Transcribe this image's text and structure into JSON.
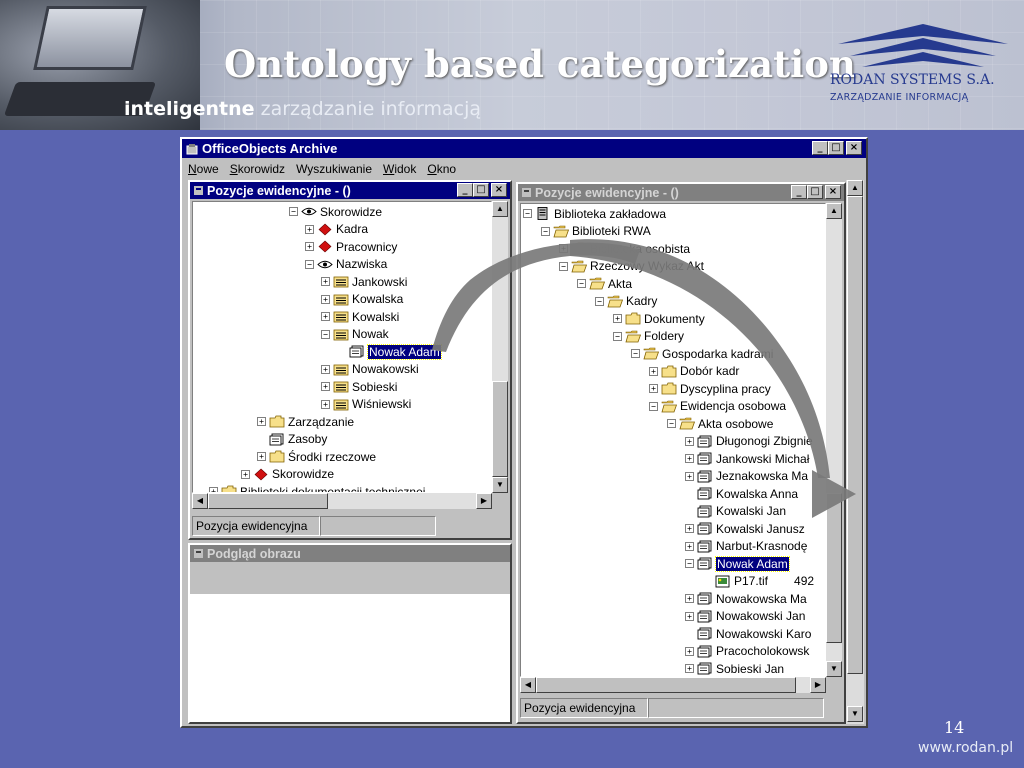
{
  "slide": {
    "title": "Ontology based categorization",
    "tagline_a": "inteligentne",
    "tagline_b": "zarządzanie informacją",
    "logo_name": "RODAN SYSTEMS S.A.",
    "logo_sub": "ZARZĄDZANIE INFORMACJĄ",
    "page_number": "14",
    "footer_url": "www.rodan.pl"
  },
  "app": {
    "title": "OfficeObjects Archive",
    "menu": [
      {
        "u": "N",
        "rest": "owe"
      },
      {
        "u": "S",
        "rest": "korowidz"
      },
      {
        "u": "W",
        "rest": "yszukiwanie"
      },
      {
        "u": "W",
        "rest": "idok"
      },
      {
        "u": "O",
        "rest": "kno"
      }
    ]
  },
  "left_window": {
    "title": "Pozycje ewidencyjne - ()",
    "status": [
      "Pozycja ewidencyjna",
      ""
    ],
    "tree": [
      {
        "label": "Skorowidze",
        "icon": "eye-icon",
        "toggle": "minus",
        "indent": 6
      },
      {
        "label": "Kadra",
        "icon": "diamond-red-icon",
        "toggle": "plus",
        "indent": 7
      },
      {
        "label": "Pracownicy",
        "icon": "diamond-red-icon",
        "toggle": "plus",
        "indent": 7
      },
      {
        "label": "Nazwiska",
        "icon": "eye-icon",
        "toggle": "minus",
        "indent": 7
      },
      {
        "label": "Jankowski",
        "icon": "folder-lines-icon",
        "toggle": "plus",
        "indent": 8
      },
      {
        "label": "Kowalska",
        "icon": "folder-lines-icon",
        "toggle": "plus",
        "indent": 8
      },
      {
        "label": "Kowalski",
        "icon": "folder-lines-icon",
        "toggle": "plus",
        "indent": 8
      },
      {
        "label": "Nowak",
        "icon": "folder-lines-icon",
        "toggle": "minus",
        "indent": 8
      },
      {
        "label": "Nowak Adam",
        "icon": "document-folder-icon",
        "toggle": "none",
        "indent": 9,
        "selected": true
      },
      {
        "label": "Nowakowski",
        "icon": "folder-lines-icon",
        "toggle": "plus",
        "indent": 8
      },
      {
        "label": "Sobieski",
        "icon": "folder-lines-icon",
        "toggle": "plus",
        "indent": 8
      },
      {
        "label": "Wiśniewski",
        "icon": "folder-lines-icon",
        "toggle": "plus",
        "indent": 8
      },
      {
        "label": "Zarządzanie",
        "icon": "folder-icon",
        "toggle": "plus",
        "indent": 4
      },
      {
        "label": "Zasoby",
        "icon": "document-folder-icon",
        "toggle": "none",
        "indent": 4
      },
      {
        "label": "Środki rzeczowe",
        "icon": "folder-icon",
        "toggle": "plus",
        "indent": 4
      },
      {
        "label": "Skorowidze",
        "icon": "diamond-red-icon",
        "toggle": "plus",
        "indent": 3
      },
      {
        "label": "Biblioteki dokumentacji technicznej",
        "icon": "folder-icon",
        "toggle": "plus",
        "indent": 1
      }
    ]
  },
  "preview_window": {
    "title": "Podgląd obrazu"
  },
  "right_window": {
    "title": "Pozycje ewidencyjne - ()",
    "status": [
      "Pozycja ewidencyjna",
      ""
    ],
    "tree": [
      {
        "label": "Biblioteka zakładowa",
        "icon": "server-icon",
        "toggle": "minus",
        "indent": 0
      },
      {
        "label": "Biblioteki RWA",
        "icon": "folder-open-icon",
        "toggle": "minus",
        "indent": 1
      },
      {
        "label": "Biblioteka osobista",
        "icon": "folder-icon",
        "toggle": "plus",
        "indent": 2
      },
      {
        "label": "Rzeczowy Wykaz Akt",
        "icon": "folder-open-icon",
        "toggle": "minus",
        "indent": 2
      },
      {
        "label": "Akta",
        "icon": "folder-open-icon",
        "toggle": "minus",
        "indent": 3
      },
      {
        "label": "Kadry",
        "icon": "folder-open-icon",
        "toggle": "minus",
        "indent": 4
      },
      {
        "label": "Dokumenty",
        "icon": "folder-icon",
        "toggle": "plus",
        "indent": 5
      },
      {
        "label": "Foldery",
        "icon": "folder-open-icon",
        "toggle": "minus",
        "indent": 5
      },
      {
        "label": "Gospodarka kadrami",
        "icon": "folder-open-icon",
        "toggle": "minus",
        "indent": 6
      },
      {
        "label": "Dobór kadr",
        "icon": "folder-icon",
        "toggle": "plus",
        "indent": 7
      },
      {
        "label": "Dyscyplina pracy",
        "icon": "folder-icon",
        "toggle": "plus",
        "indent": 7
      },
      {
        "label": "Ewidencja osobowa",
        "icon": "folder-open-icon",
        "toggle": "minus",
        "indent": 7
      },
      {
        "label": "Akta osobowe",
        "icon": "folder-open-icon",
        "toggle": "minus",
        "indent": 8
      },
      {
        "label": "Długonogi Zbignie",
        "icon": "document-folder-icon",
        "toggle": "plus",
        "indent": 9
      },
      {
        "label": "Jankowski Michał",
        "icon": "document-folder-icon",
        "toggle": "plus",
        "indent": 9
      },
      {
        "label": "Jeznakowska Ma",
        "icon": "document-folder-icon",
        "toggle": "plus",
        "indent": 9
      },
      {
        "label": "Kowalska Anna",
        "icon": "document-folder-icon",
        "toggle": "none",
        "indent": 9
      },
      {
        "label": "Kowalski Jan",
        "icon": "document-folder-icon",
        "toggle": "none",
        "indent": 9
      },
      {
        "label": "Kowalski Janusz",
        "icon": "document-folder-icon",
        "toggle": "plus",
        "indent": 9
      },
      {
        "label": "Narbut-Krasnodę",
        "icon": "document-folder-icon",
        "toggle": "plus",
        "indent": 9
      },
      {
        "label": "Nowak Adam",
        "icon": "document-folder-icon",
        "toggle": "minus",
        "indent": 9,
        "selected": true
      },
      {
        "label": "P17.tif",
        "icon": "image-file-icon",
        "toggle": "none",
        "indent": 10,
        "extra": "492"
      },
      {
        "label": "Nowakowska Ma",
        "icon": "document-folder-icon",
        "toggle": "plus",
        "indent": 9
      },
      {
        "label": "Nowakowski Jan",
        "icon": "document-folder-icon",
        "toggle": "plus",
        "indent": 9
      },
      {
        "label": "Nowakowski Karo",
        "icon": "document-folder-icon",
        "toggle": "none",
        "indent": 9
      },
      {
        "label": "Pracocholokowsk",
        "icon": "document-folder-icon",
        "toggle": "plus",
        "indent": 9
      },
      {
        "label": "Sobieski Jan",
        "icon": "document-folder-icon",
        "toggle": "plus",
        "indent": 9
      }
    ]
  },
  "colors": {
    "background": "#5a64b0",
    "window_title": "#000080",
    "arrow": "#7a7a7a"
  }
}
